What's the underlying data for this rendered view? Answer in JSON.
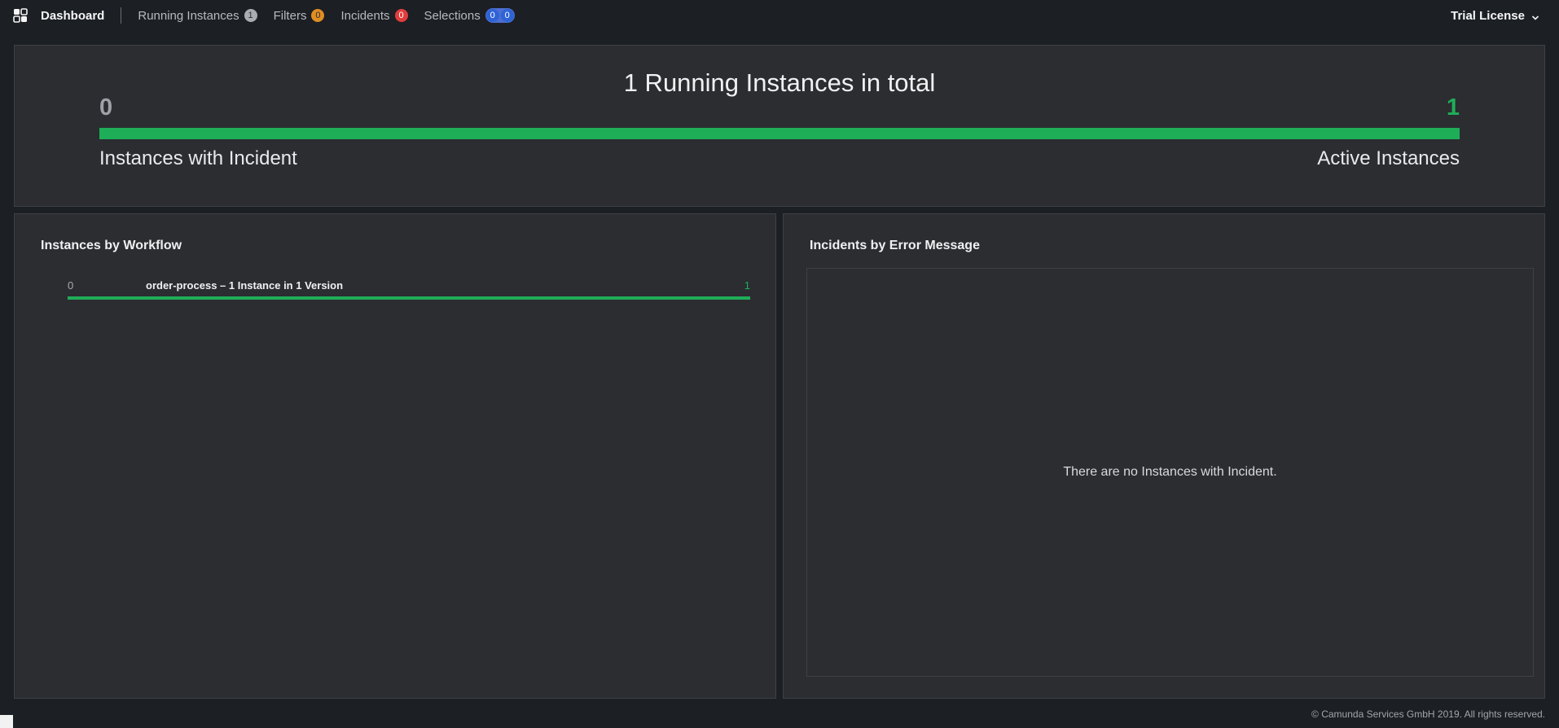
{
  "header": {
    "dashboard_label": "Dashboard",
    "nav": {
      "running_instances": {
        "label": "Running Instances",
        "count": "1"
      },
      "filters": {
        "label": "Filters",
        "count": "0"
      },
      "incidents": {
        "label": "Incidents",
        "count": "0"
      },
      "selections": {
        "label": "Selections",
        "count_a": "0",
        "count_b": "0"
      }
    },
    "license_label": "Trial License",
    "icons": [
      "camunda-logo-icon",
      "chevron-down-icon"
    ]
  },
  "summary": {
    "title": "1 Running Instances in total",
    "incident_count": "0",
    "active_count": "1",
    "incident_label": "Instances with Incident",
    "active_label": "Active Instances",
    "active_fraction": 1.0
  },
  "workflow_panel": {
    "title": "Instances by Workflow",
    "rows": [
      {
        "incident_count": "0",
        "label": "order-process – 1 Instance in 1 Version",
        "active_count": "1"
      }
    ]
  },
  "incident_panel": {
    "title": "Incidents by Error Message",
    "empty_message": "There are no Instances with Incident."
  },
  "footer": {
    "copyright": "© Camunda Services GmbH 2019. All rights reserved."
  },
  "colors": {
    "background": "#1c1f23",
    "panel": "#2b2d31",
    "active_green": "#1fae58",
    "badge_orange": "#e08e23",
    "badge_red": "#e23d3d",
    "badge_blue": "#2e63d6"
  }
}
